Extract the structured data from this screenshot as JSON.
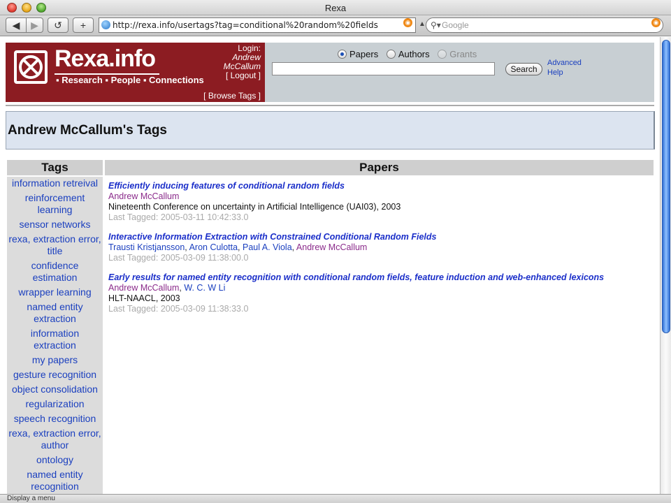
{
  "window": {
    "title": "Rexa"
  },
  "toolbar": {
    "back_label": "◀",
    "forward_label": "▶",
    "reload_label": "↺",
    "add_label": "+",
    "url": "http://rexa.info/usertags?tag=conditional%20random%20fields",
    "search_placeholder": "Google"
  },
  "header": {
    "logo_name": "Rexa.info",
    "logo_tagline": "▪ Research ▪ People ▪ Connections",
    "login_label": "Login:",
    "user_first": "Andrew",
    "user_last": "McCallum",
    "logout_label": "[ Logout ]",
    "browse_tags_label": "[ Browse Tags ]"
  },
  "search": {
    "options": [
      {
        "label": "Papers",
        "selected": true,
        "enabled": true
      },
      {
        "label": "Authors",
        "selected": false,
        "enabled": true
      },
      {
        "label": "Grants",
        "selected": false,
        "enabled": false
      }
    ],
    "query": "",
    "button_label": "Search",
    "advanced_label": "Advanced",
    "help_label": "Help"
  },
  "page": {
    "title": "Andrew McCallum's Tags"
  },
  "table": {
    "tags_header": "Tags",
    "papers_header": "Papers",
    "tags": [
      "information retreival",
      "reinforcement learning",
      "sensor networks",
      "rexa, extraction error, title",
      "confidence estimation",
      "wrapper learning",
      "named entity extraction",
      "information extraction",
      "my papers",
      "gesture recognition",
      "object consolidation",
      "regularization",
      "speech recognition",
      "rexa, extraction error, author",
      "ontology",
      "named entity recognition"
    ],
    "papers": [
      {
        "title": "Efficiently inducing features of conditional random fields",
        "authors": [
          "Andrew McCallum"
        ],
        "venue": "Nineteenth Conference on uncertainty in Artificial Intelligence (UAI03), 2003",
        "last_tagged": "Last Tagged: 2005-03-11 10:42:33.0"
      },
      {
        "title": "Interactive Information Extraction with Constrained Conditional Random Fields",
        "authors": [
          "Trausti Kristjansson",
          "Aron Culotta",
          "Paul A. Viola",
          "Andrew McCallum"
        ],
        "venue": "",
        "last_tagged": "Last Tagged: 2005-03-09 11:38:00.0"
      },
      {
        "title": "Early results for named entity recognition with conditional random fields, feature induction and web-enhanced lexicons",
        "authors": [
          "Andrew McCallum",
          "W. C. W Li"
        ],
        "venue": "HLT-NAACL, 2003",
        "last_tagged": "Last Tagged: 2005-03-09 11:38:33.0"
      }
    ]
  },
  "status_bar": {
    "text": "Display a menu"
  },
  "colors": {
    "brand": "#8c1c22",
    "link": "#1a3fbf",
    "author": "#8b2b8b"
  }
}
